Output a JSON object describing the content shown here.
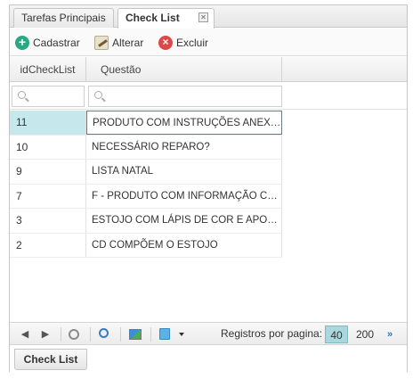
{
  "tabs": [
    {
      "label": "Tarefas Principais"
    },
    {
      "label": "Check List"
    }
  ],
  "tab_close_glyph": "✕",
  "actions": {
    "add": "Cadastrar",
    "edit": "Alterar",
    "delete": "Excluir"
  },
  "columns": [
    "idCheckList",
    "Questão"
  ],
  "rows": [
    {
      "id": "11",
      "question": "PRODUTO COM INSTRUÇÕES ANEXAS?"
    },
    {
      "id": "10",
      "question": "NECESSÁRIO REPARO?"
    },
    {
      "id": "9",
      "question": "LISTA NATAL"
    },
    {
      "id": "7",
      "question": "F - PRODUTO COM INFORMAÇÃO CORRETA?"
    },
    {
      "id": "3",
      "question": "ESTOJO COM LÁPIS DE COR E APONTADOR?"
    },
    {
      "id": "2",
      "question": "CD COMPÕEM O ESTOJO"
    }
  ],
  "selected_row": 0,
  "pager": {
    "label": "Registros por pagina:",
    "options": [
      "40",
      "200"
    ],
    "selected": "40",
    "next_glyph": "»"
  },
  "bottom_tab": "Check List",
  "colors": {
    "accent": "#a9d7dd",
    "selection": "#cde8ef",
    "add_icon": "#2aa880",
    "delete_icon": "#e04848"
  }
}
